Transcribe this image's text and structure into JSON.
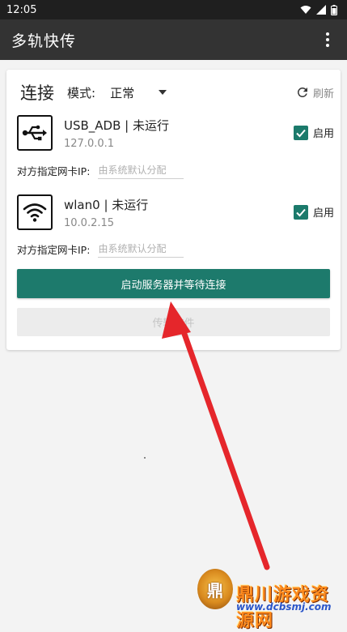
{
  "status_bar": {
    "time": "12:05"
  },
  "app_bar": {
    "title": "多轨快传"
  },
  "connection": {
    "title": "连接",
    "mode_label": "模式:",
    "mode_value": "正常",
    "refresh_label": "刷新"
  },
  "interfaces": [
    {
      "name": "USB_ADB | 未运行",
      "ip": "127.0.0.1",
      "enable_label": "启用",
      "enabled": true,
      "peer_label": "对方指定网卡IP:",
      "peer_placeholder": "由系统默认分配",
      "icon": "usb-icon"
    },
    {
      "name": "wlan0 | 未运行",
      "ip": "10.0.2.15",
      "enable_label": "启用",
      "enabled": true,
      "peer_label": "对方指定网卡IP:",
      "peer_placeholder": "由系统默认分配",
      "icon": "wifi-icon"
    }
  ],
  "buttons": {
    "start_server": "启动服务器并等待连接",
    "transfer_files": "传输文件"
  },
  "watermark": {
    "logo_glyph": "鼎",
    "title": "鼎川游戏资源网",
    "url": "www.dcbsmj.com"
  },
  "colors": {
    "accent": "#1d7a6c",
    "app_bar": "#333333",
    "status_bar": "#1f1f1f",
    "arrow": "#e5262b"
  }
}
